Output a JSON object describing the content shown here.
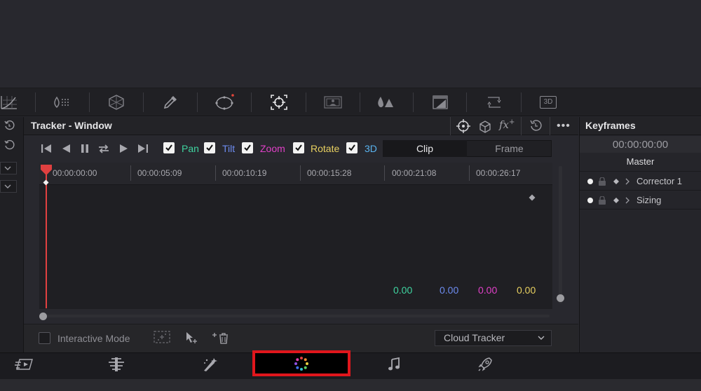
{
  "palette_tools": [
    {
      "name": "curves-icon"
    },
    {
      "name": "color-warper-icon"
    },
    {
      "name": "hsl-qualifier-icon"
    },
    {
      "name": "power-window-icon"
    },
    {
      "name": "tracker-icon"
    },
    {
      "name": "magic-mask-icon"
    },
    {
      "name": "blur-icon"
    },
    {
      "name": "key-icon"
    },
    {
      "name": "sizing-icon"
    },
    {
      "name": "3d-icon",
      "text": "3D"
    }
  ],
  "tracker": {
    "title": "Tracker - Window",
    "transport": [
      "skip-to-start-icon",
      "reverse-icon",
      "pause-icon",
      "loop-icon",
      "play-icon",
      "skip-to-end-icon"
    ],
    "checkboxes": [
      {
        "label": "Pan",
        "color": "#3fd4a0",
        "checked": true
      },
      {
        "label": "Tilt",
        "color": "#6d8cf0",
        "checked": true
      },
      {
        "label": "Zoom",
        "color": "#e040c8",
        "checked": true
      },
      {
        "label": "Rotate",
        "color": "#e8d060",
        "checked": true
      },
      {
        "label": "3D",
        "color": "#5ab4f0",
        "checked": true
      }
    ],
    "mode_clip": "Clip",
    "mode_frame": "Frame",
    "timecodes": [
      "00:00:00:00",
      "00:00:05:09",
      "00:00:10:19",
      "00:00:15:28",
      "00:00:21:08",
      "00:00:26:17"
    ],
    "values": [
      {
        "text": "0.00",
        "color": "#3fd4a0"
      },
      {
        "text": "0.00",
        "color": "#6d8cf0"
      },
      {
        "text": "0.00",
        "color": "#e040c8"
      },
      {
        "text": "0.00",
        "color": "#e8d060"
      }
    ],
    "interactive_mode": "Interactive Mode",
    "cloud_tracker": "Cloud Tracker"
  },
  "keyframes": {
    "title": "Keyframes",
    "timecode": "00:00:00:00",
    "master": "Master",
    "rows": [
      "Corrector 1",
      "Sizing"
    ]
  },
  "page_nav": {
    "items": [
      "media-icon",
      "edit-icon",
      "fusion-icon",
      "color-icon",
      "fairlight-icon",
      "deliver-icon"
    ],
    "active": "color-icon"
  },
  "colors": {
    "accent_red": "#e0161c",
    "playhead": "#e04040"
  }
}
